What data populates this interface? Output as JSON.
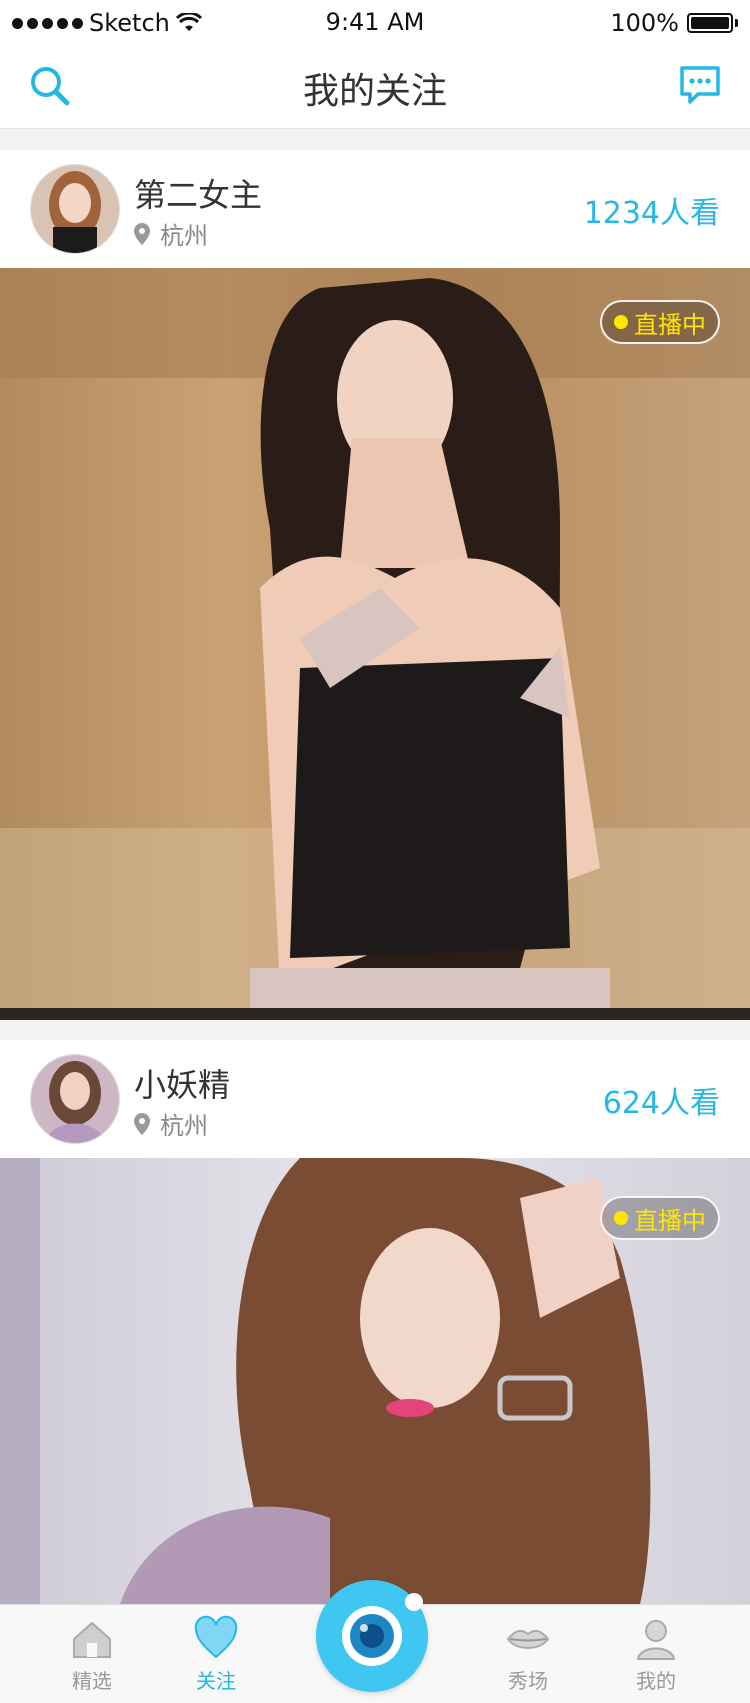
{
  "status": {
    "carrier": "Sketch",
    "time": "9:41 AM",
    "battery": "100%"
  },
  "header": {
    "title": "我的关注"
  },
  "feed": [
    {
      "name": "第二女主",
      "location": "杭州",
      "viewers": "1234人看",
      "live": "直播中"
    },
    {
      "name": "小妖精",
      "location": "杭州",
      "viewers": "624人看",
      "live": "直播中"
    }
  ],
  "tabs": [
    {
      "label": "精选",
      "icon": "home-icon"
    },
    {
      "label": "关注",
      "icon": "heart-icon"
    },
    {
      "label": "",
      "icon": "camera-icon"
    },
    {
      "label": "秀场",
      "icon": "lips-icon"
    },
    {
      "label": "我的",
      "icon": "user-icon"
    }
  ],
  "colors": {
    "accent": "#25b7e6",
    "live": "#ffe600",
    "center": "#3fc7f1"
  }
}
